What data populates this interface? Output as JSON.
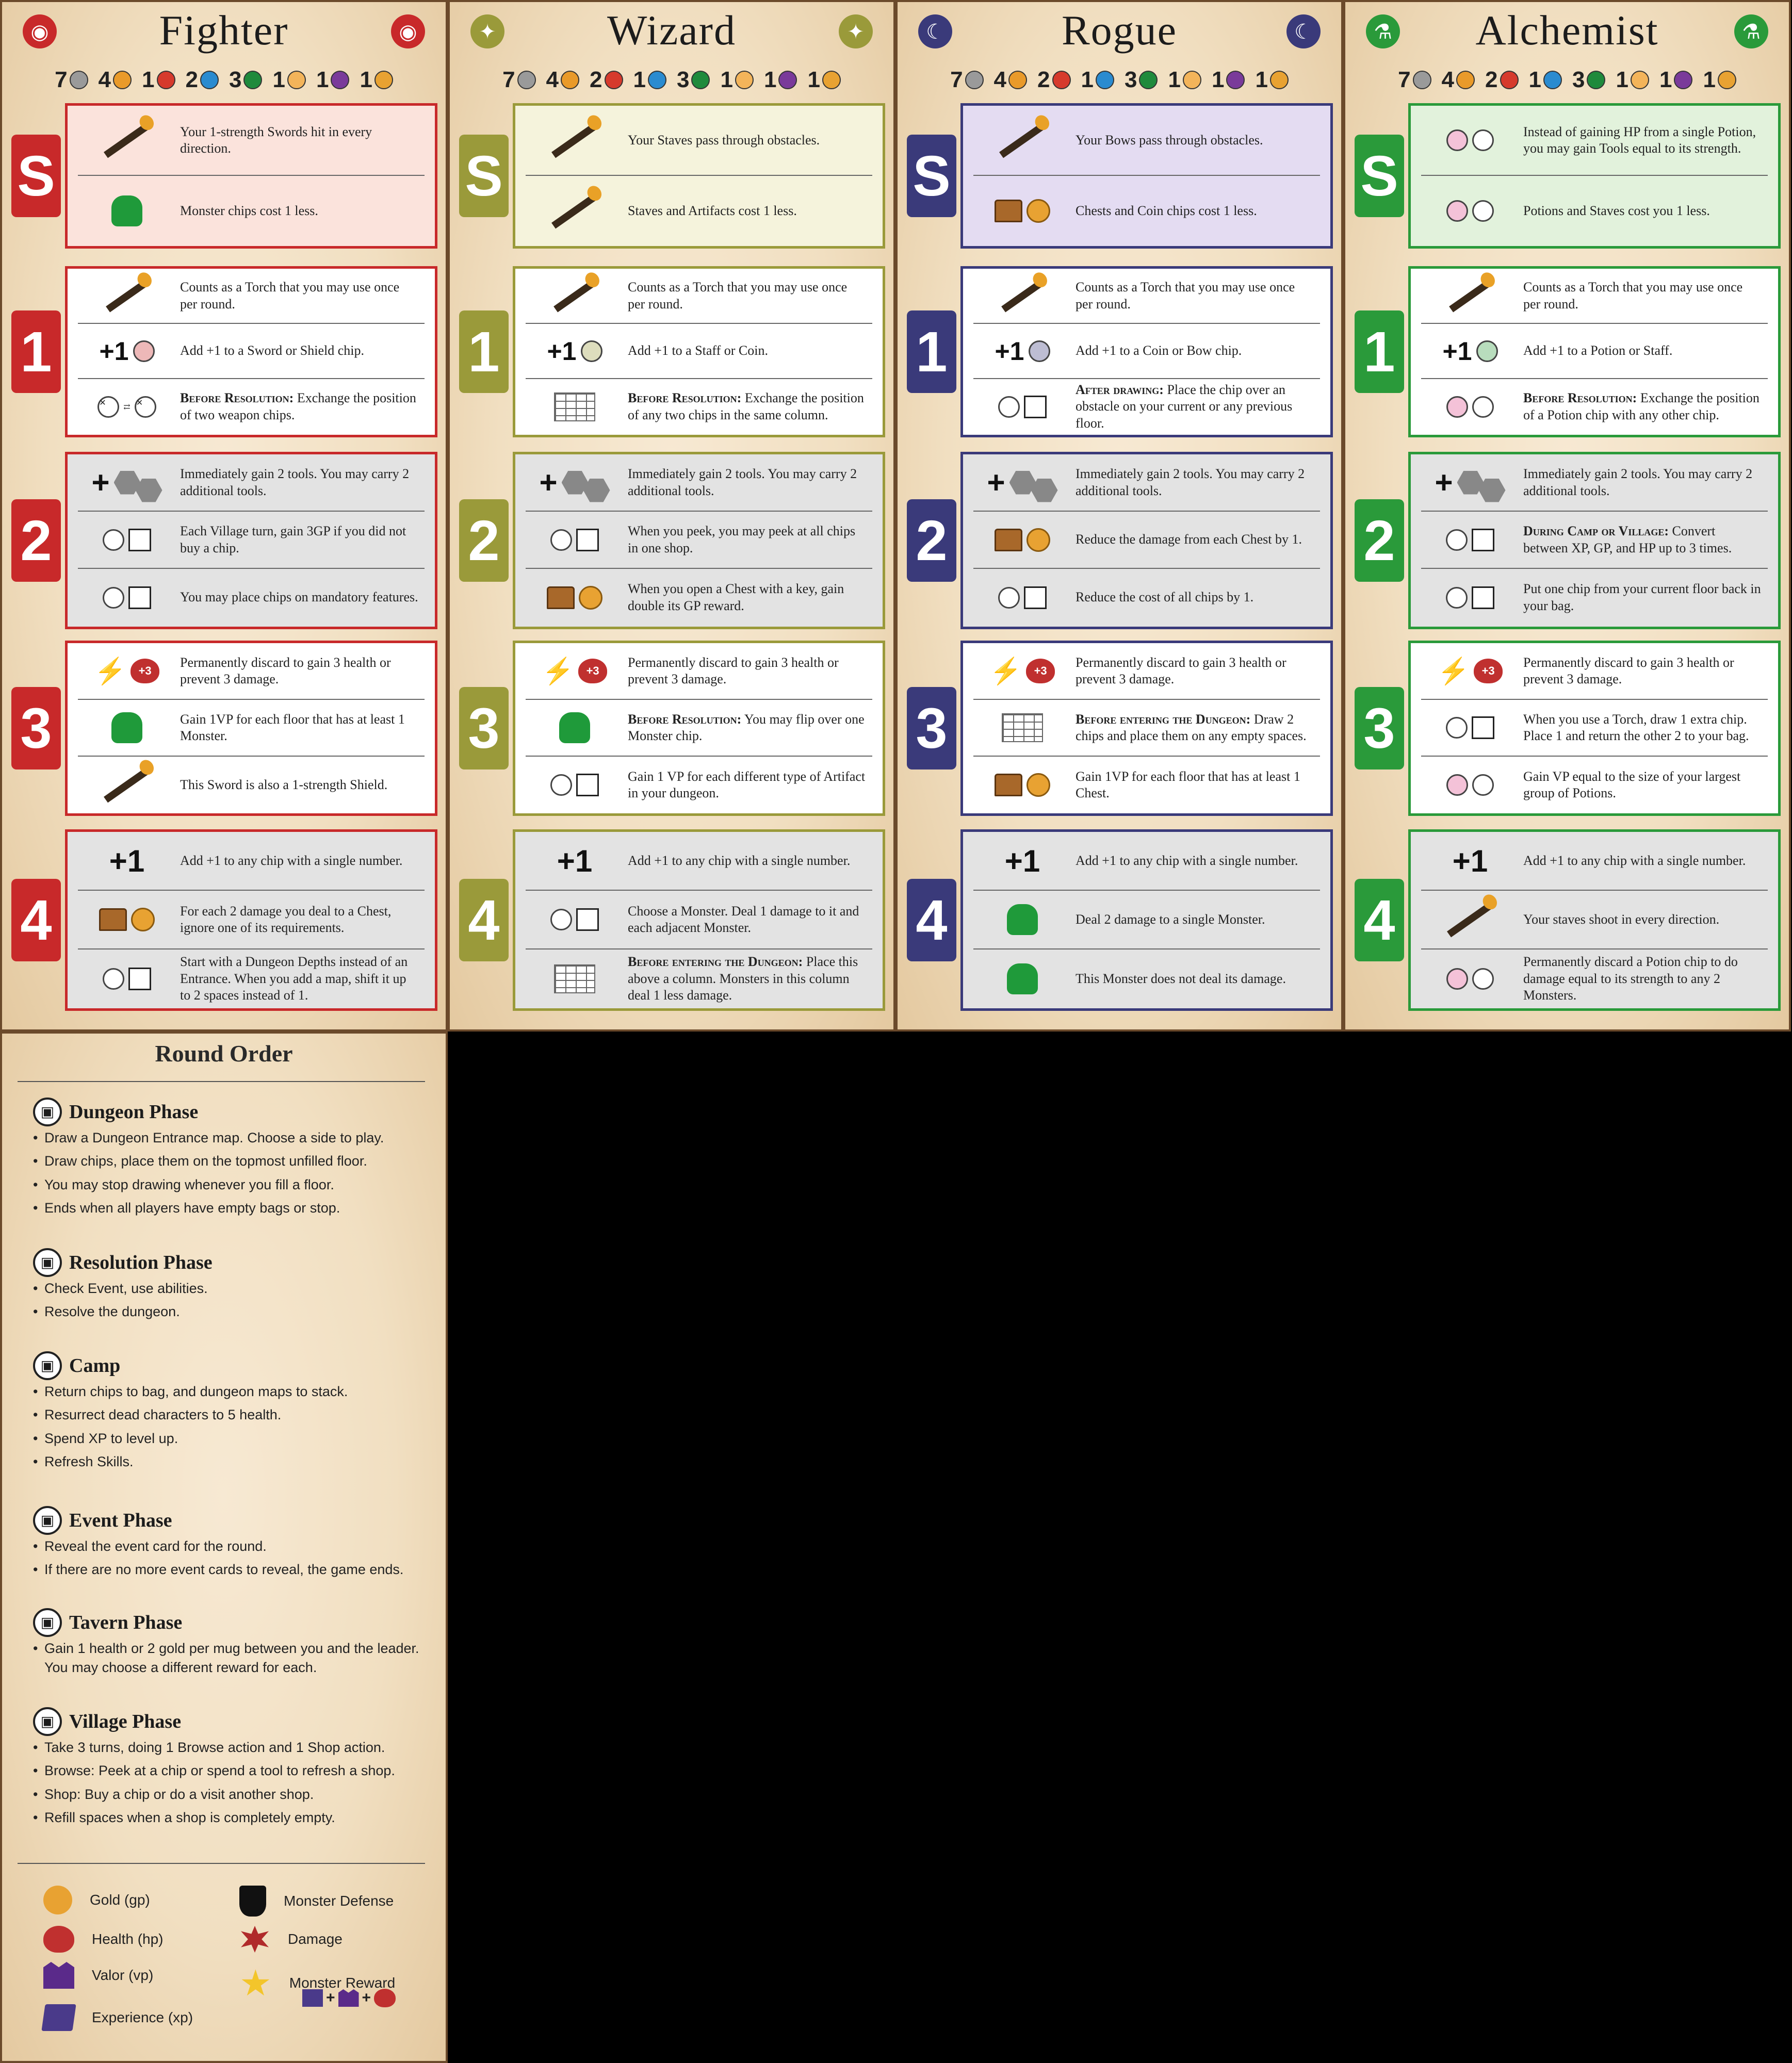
{
  "stat_colors": [
    "#9a9a9a",
    "#e99a2a",
    "#d63a2c",
    "#2a8bd0",
    "#1f8a3c",
    "#f3b45a",
    "#7a3a9a",
    "#e8a232"
  ],
  "cards": [
    {
      "id": "fighter",
      "title": "Fighter",
      "color": "#c8292a",
      "icon": "helmet-icon",
      "icon_glyph": "◉",
      "stats": [
        "7",
        "4",
        "1",
        "2",
        "3",
        "1",
        "1",
        "1"
      ],
      "skill": {
        "badge": "S",
        "bg": "#fbe3dc",
        "rows": [
          {
            "icon": "sword-icon",
            "text": "Your 1-strength Swords hit in every direction."
          },
          {
            "icon": "monster-chip-icon",
            "text": "Monster chips cost 1 less."
          }
        ]
      },
      "levels": [
        {
          "badge": "1",
          "bg": "#ffffff",
          "rows": [
            {
              "icon": "torch-icon",
              "text": "Counts as a Torch that you may use once per round."
            },
            {
              "icon": "plus-one-sword-shield-icon",
              "text": "Add +1 to a Sword or Shield chip."
            },
            {
              "icon": "exchange-icon",
              "sc": "Before Resolution:",
              "text": " Exchange the position of two weapon chips."
            }
          ]
        },
        {
          "badge": "2",
          "bg": "#e3e3e3",
          "rows": [
            {
              "icon": "tools-icon",
              "text": "Immediately gain 2 tools. You may carry 2 additional tools."
            },
            {
              "icon": "village-gold-icon",
              "text": "Each Village turn, gain 3GP if you did not buy a chip."
            },
            {
              "icon": "mandatory-feature-icon",
              "text": "You may place chips on mandatory features."
            }
          ]
        },
        {
          "badge": "3",
          "bg": "#ffffff",
          "rows": [
            {
              "icon": "heart-plus-three-icon",
              "text": "Permanently discard to gain 3 health or prevent 3 damage."
            },
            {
              "icon": "floor-monster-icon",
              "text": "Gain 1VP for each floor that has at least 1 Monster."
            },
            {
              "icon": "sword-shield-icon",
              "text": "This Sword is also a 1-strength Shield."
            }
          ]
        },
        {
          "badge": "4",
          "bg": "#e3e3e3",
          "rows": [
            {
              "icon": "plus-one-icon",
              "text": "Add +1 to any chip with a single number."
            },
            {
              "icon": "chest-damage-icon",
              "text": "For each 2 damage you deal to a Chest, ignore one of its requirements."
            },
            {
              "icon": "dungeon-depths-icon",
              "text": "Start with a Dungeon Depths instead of an Entrance. When you add a map, shift it up to 2 spaces instead of 1."
            }
          ]
        }
      ]
    },
    {
      "id": "wizard",
      "title": "Wizard",
      "color": "#9a9a3a",
      "icon": "star-icon",
      "icon_glyph": "✦",
      "stats": [
        "7",
        "4",
        "2",
        "1",
        "3",
        "1",
        "1",
        "1"
      ],
      "skill": {
        "badge": "S",
        "bg": "#f5f3dc",
        "rows": [
          {
            "icon": "staff-icon",
            "text": "Your Staves pass through obstacles."
          },
          {
            "icon": "artifact-staff-icon",
            "text": "Staves and Artifacts cost 1 less."
          }
        ]
      },
      "levels": [
        {
          "badge": "1",
          "bg": "#ffffff",
          "rows": [
            {
              "icon": "torch-icon",
              "text": "Counts as a Torch that you may use once per round."
            },
            {
              "icon": "plus-one-staff-coin-icon",
              "text": "Add +1 to a Staff or Coin."
            },
            {
              "icon": "column-exchange-icon",
              "sc": "Before Resolution:",
              "text": " Exchange the position of any two chips in the same column."
            }
          ]
        },
        {
          "badge": "2",
          "bg": "#e3e3e3",
          "rows": [
            {
              "icon": "tools-icon",
              "text": "Immediately gain 2 tools. You may carry 2 additional tools."
            },
            {
              "icon": "peek-icon",
              "text": "When you peek, you may peek at all chips in one shop."
            },
            {
              "icon": "chest-key-icon",
              "text": "When you open a Chest with a key, gain double its GP reward."
            }
          ]
        },
        {
          "badge": "3",
          "bg": "#ffffff",
          "rows": [
            {
              "icon": "heart-plus-three-icon",
              "text": "Permanently discard to gain 3 health or prevent 3 damage."
            },
            {
              "icon": "flip-monster-icon",
              "sc": "Before Resolution:",
              "text": " You may flip over one Monster chip."
            },
            {
              "icon": "artifact-vp-icon",
              "text": "Gain 1 VP for each different type of Artifact in your dungeon."
            }
          ]
        },
        {
          "badge": "4",
          "bg": "#e3e3e3",
          "rows": [
            {
              "icon": "plus-one-icon",
              "text": "Add +1 to any chip with a single number."
            },
            {
              "icon": "adjacent-damage-icon",
              "text": "Choose a Monster. Deal 1 damage to it and each adjacent Monster."
            },
            {
              "icon": "column-damage-icon",
              "sc": "Before entering the Dungeon:",
              "text": " Place this above a column. Monsters in this column deal 1 less damage."
            }
          ]
        }
      ]
    },
    {
      "id": "rogue",
      "title": "Rogue",
      "color": "#3a3a7a",
      "icon": "moon-icon",
      "icon_glyph": "☾",
      "stats": [
        "7",
        "4",
        "2",
        "1",
        "3",
        "1",
        "1",
        "1"
      ],
      "skill": {
        "badge": "S",
        "bg": "#e4dcf2",
        "rows": [
          {
            "icon": "bow-icon",
            "text": "Your Bows pass through obstacles."
          },
          {
            "icon": "chest-coin-icon",
            "text": "Chests and Coin chips cost 1 less."
          }
        ]
      },
      "levels": [
        {
          "badge": "1",
          "bg": "#ffffff",
          "rows": [
            {
              "icon": "torch-icon",
              "text": "Counts as a Torch that you may use once per round."
            },
            {
              "icon": "plus-one-coin-bow-icon",
              "text": "Add +1 to a Coin or Bow chip."
            },
            {
              "icon": "obstacle-icon",
              "sc": "After drawing:",
              "text": " Place the chip over an obstacle on your current or any previous floor."
            }
          ]
        },
        {
          "badge": "2",
          "bg": "#e3e3e3",
          "rows": [
            {
              "icon": "tools-icon",
              "text": "Immediately gain 2 tools. You may carry 2 additional tools."
            },
            {
              "icon": "chest-reduce-icon",
              "text": "Reduce the damage from each Chest by 1."
            },
            {
              "icon": "minus-one-tag-icon",
              "text": "Reduce the cost of all chips by 1."
            }
          ]
        },
        {
          "badge": "3",
          "bg": "#ffffff",
          "rows": [
            {
              "icon": "heart-plus-three-icon",
              "text": "Permanently discard to gain 3 health or prevent 3 damage."
            },
            {
              "icon": "draw-place-icon",
              "sc": "Before entering the Dungeon:",
              "text": " Draw 2 chips and place them on any empty spaces."
            },
            {
              "icon": "floor-chest-icon",
              "text": "Gain 1VP for each floor that has at least 1 Chest."
            }
          ]
        },
        {
          "badge": "4",
          "bg": "#e3e3e3",
          "rows": [
            {
              "icon": "plus-one-icon",
              "text": "Add +1 to any chip with a single number."
            },
            {
              "icon": "monster-damage-icon",
              "text": "Deal 2 damage to a single Monster."
            },
            {
              "icon": "monster-zero-icon",
              "text": "This Monster does not deal its damage."
            }
          ]
        }
      ]
    },
    {
      "id": "alchemist",
      "title": "Alchemist",
      "color": "#2a9a3a",
      "icon": "potion-icon",
      "icon_glyph": "⚗",
      "stats": [
        "7",
        "4",
        "2",
        "1",
        "3",
        "1",
        "1",
        "1"
      ],
      "skill": {
        "badge": "S",
        "bg": "#e2f2dc",
        "rows": [
          {
            "icon": "potion-tools-icon",
            "text": "Instead of gaining HP from a single Potion, you may gain Tools equal to its strength."
          },
          {
            "icon": "potion-staff-icon",
            "text": "Potions and Staves cost you 1 less."
          }
        ]
      },
      "levels": [
        {
          "badge": "1",
          "bg": "#ffffff",
          "rows": [
            {
              "icon": "torch-icon",
              "text": "Counts as a Torch that you may use once per round."
            },
            {
              "icon": "plus-one-potion-staff-icon",
              "text": "Add +1 to a Potion or Staff."
            },
            {
              "icon": "potion-exchange-icon",
              "sc": "Before Resolution:",
              "text": " Exchange the position of a Potion chip with any other chip."
            }
          ]
        },
        {
          "badge": "2",
          "bg": "#e3e3e3",
          "rows": [
            {
              "icon": "tools-icon",
              "text": "Immediately gain 2 tools. You may carry 2 additional tools."
            },
            {
              "icon": "convert-icon",
              "sc": "During Camp or Village:",
              "text": " Convert between XP, GP, and HP up to 3 times."
            },
            {
              "icon": "bag-return-icon",
              "text": "Put one chip from your current floor back in your bag."
            }
          ]
        },
        {
          "badge": "3",
          "bg": "#ffffff",
          "rows": [
            {
              "icon": "heart-plus-three-icon",
              "text": "Permanently discard to gain 3 health or prevent 3 damage."
            },
            {
              "icon": "torch-draw-icon",
              "text": "When you use a Torch, draw 1 extra chip. Place 1 and return the other 2 to your bag."
            },
            {
              "icon": "potion-group-icon",
              "text": "Gain VP equal to the size of your largest group of Potions."
            }
          ]
        },
        {
          "badge": "4",
          "bg": "#e3e3e3",
          "rows": [
            {
              "icon": "plus-one-icon",
              "text": "Add +1 to any chip with a single number."
            },
            {
              "icon": "staff-burst-icon",
              "text": "Your staves shoot in every direction."
            },
            {
              "icon": "potion-damage-icon",
              "text": "Permanently discard a Potion chip to do damage equal to its strength to any 2 Monsters."
            }
          ]
        }
      ]
    }
  ],
  "round_order": {
    "title": "Round Order",
    "phases": [
      {
        "name": "Dungeon Phase",
        "icon": "dungeon-entrance-icon",
        "items": [
          "Draw a Dungeon Entrance map. Choose a side to play.",
          "Draw chips, place them on the topmost unfilled floor.",
          "You may stop drawing whenever you fill a floor.",
          "Ends when all players have empty bags or stop."
        ]
      },
      {
        "name": "Resolution Phase",
        "icon": "chest-phase-icon",
        "items": [
          "Check Event, use abilities.",
          "Resolve the dungeon."
        ]
      },
      {
        "name": "Camp",
        "icon": "camp-icon",
        "items": [
          "Return chips to bag, and dungeon maps to stack.",
          "Resurrect dead characters to 5 health.",
          "Spend XP to level up.",
          "Refresh Skills."
        ]
      },
      {
        "name": "Event Phase",
        "icon": "scroll-icon",
        "items": [
          "Reveal the event card for the round.",
          "If there are no more event cards to reveal, the game ends."
        ]
      },
      {
        "name": "Tavern Phase",
        "icon": "mug-icon",
        "items": [
          "Gain 1 health or 2 gold per mug between you and the leader. You may choose a different reward for each."
        ]
      },
      {
        "name": "Village Phase",
        "icon": "village-icon",
        "items": [
          "Take 3 turns, doing 1 Browse action and 1 Shop action.",
          "Browse: Peek at a chip or spend a tool to refresh a shop.",
          "Shop: Buy a chip or do a visit another shop.",
          "Refill spaces when a shop is completely empty."
        ]
      }
    ],
    "legend": [
      {
        "label": "Gold (gp)",
        "icon": "gold-icon",
        "color": "#e8a232"
      },
      {
        "label": "Monster Defense",
        "icon": "shield-icon",
        "color": "#111111"
      },
      {
        "label": "Health (hp)",
        "icon": "heart-icon",
        "color": "#c0302f"
      },
      {
        "label": "Damage",
        "icon": "damage-burst-icon",
        "color": "#b02a2a"
      },
      {
        "label": "Valor (vp)",
        "icon": "valor-crown-icon",
        "color": "#5a2a8a"
      },
      {
        "label": "Monster Reward",
        "icon": "star-reward-icon",
        "color": "#f3c52b"
      },
      {
        "label": "Experience (xp)",
        "icon": "xp-scroll-icon",
        "color": "#4a3a8a"
      }
    ],
    "reward_plus": "+"
  }
}
